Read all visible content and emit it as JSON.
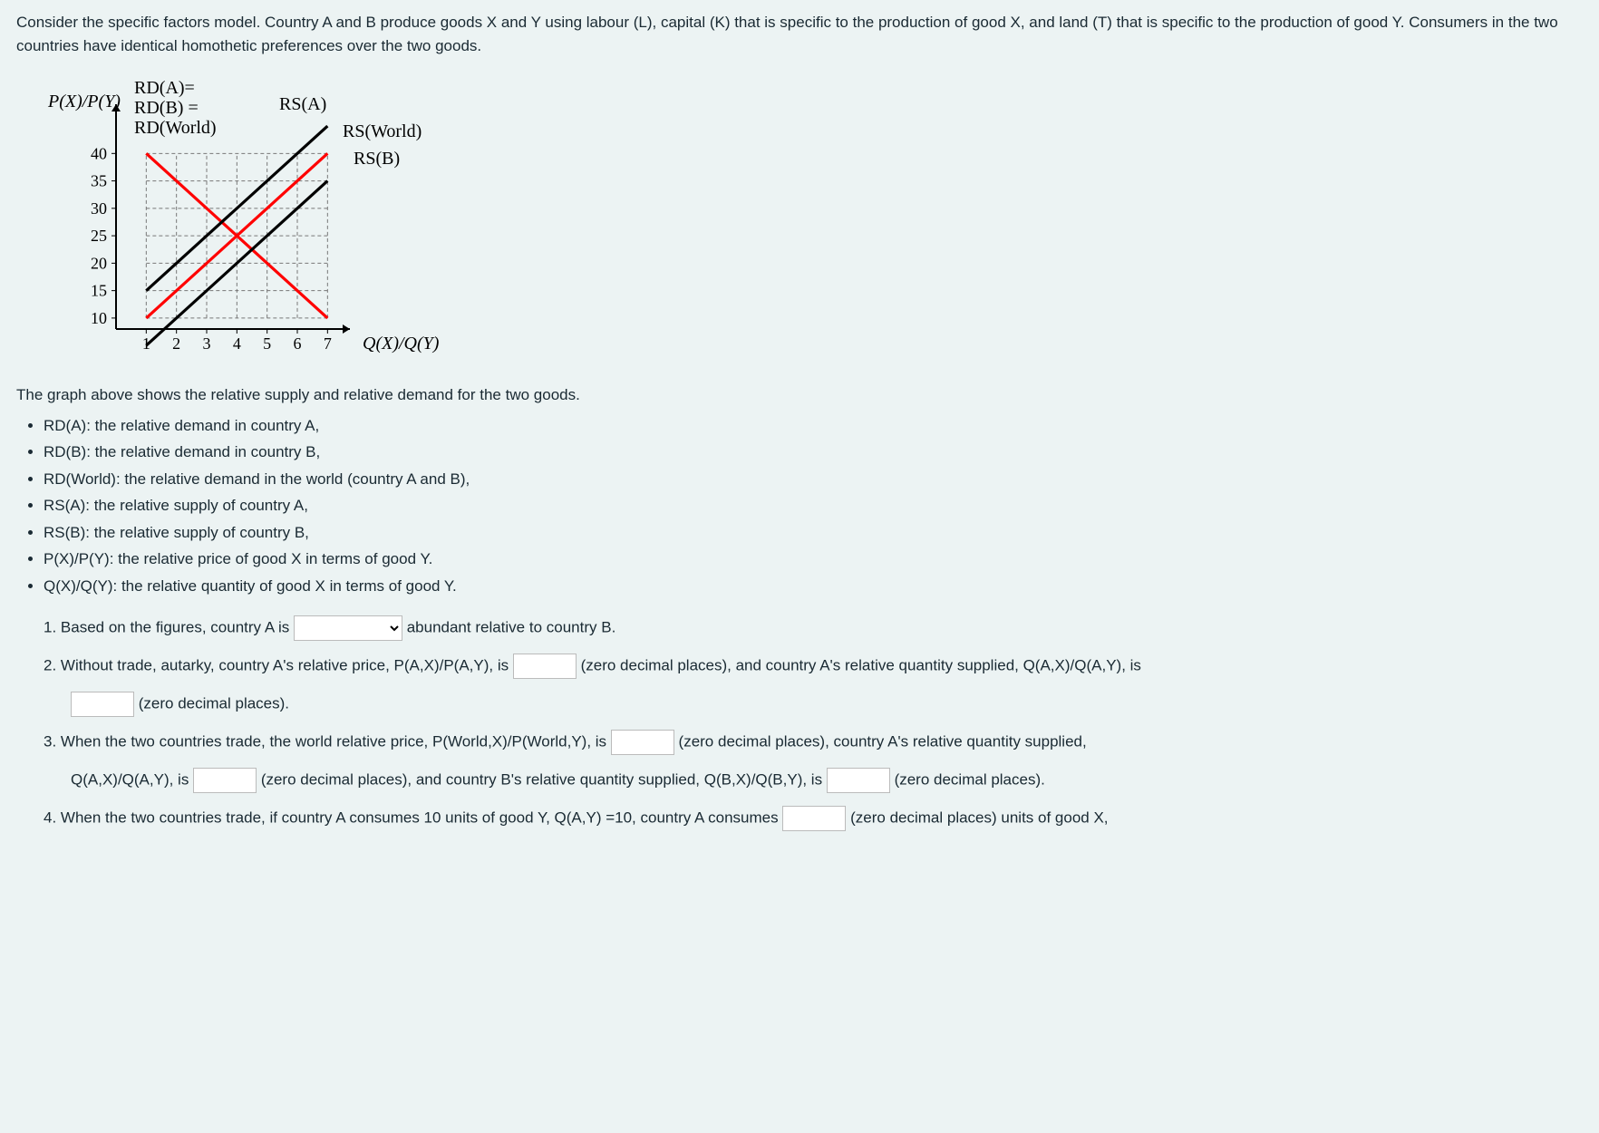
{
  "intro": "Consider the specific factors model. Country A and B produce goods X and Y using labour (L), capital (K) that is specific to the production of good X, and land (T) that is specific to the production of good Y. Consumers in the two countries have identical homothetic preferences over the two goods.",
  "chart_caption": "The graph above shows the relative supply and relative demand for the two goods.",
  "defs": [
    "RD(A): the relative demand in country A,",
    "RD(B): the relative demand in country B,",
    "RD(World): the relative demand in the world (country A and B),",
    "RS(A): the relative supply of country A,",
    "RS(B): the relative supply of country B,",
    "P(X)/P(Y): the relative price of good X in terms of good Y.",
    "Q(X)/Q(Y): the relative quantity of good X in terms of good Y."
  ],
  "q1": {
    "pre": "1. Based on the figures, country A is",
    "post": "abundant relative to country B."
  },
  "q2": {
    "pre": "2. Without trade, autarky, country A's relative price, P(A,X)/P(A,Y), is",
    "mid": "(zero decimal places), and country A's relative quantity supplied, Q(A,X)/Q(A,Y), is",
    "tail": "(zero decimal places)."
  },
  "q3": {
    "pre": "3. When the two countries trade, the world relative price, P(World,X)/P(World,Y), is",
    "mid1": "(zero decimal places), country A's relative quantity supplied,",
    "line2_pre": "Q(A,X)/Q(A,Y), is",
    "mid2": "(zero decimal places), and country B's relative quantity supplied, Q(B,X)/Q(B,Y), is",
    "tail": "(zero decimal places)."
  },
  "q4": {
    "pre": "4. When the two countries trade, if country A consumes 10 units of good Y, Q(A,Y) =10, country A consumes",
    "tail": "(zero decimal places) units of good X,"
  },
  "chart_data": {
    "type": "line",
    "xlabel": "Q(X)/Q(Y)",
    "ylabel": "P(X)/P(Y)",
    "x_ticks": [
      1,
      2,
      3,
      4,
      5,
      6,
      7
    ],
    "y_ticks": [
      10,
      15,
      20,
      25,
      30,
      35,
      40
    ],
    "xlim": [
      0,
      7.5
    ],
    "ylim": [
      8,
      46
    ],
    "series": [
      {
        "name": "RD(A) = RD(B) = RD(World)",
        "color": "#ff0000",
        "points": [
          [
            1,
            40
          ],
          [
            7,
            10
          ]
        ]
      },
      {
        "name": "RS(World)",
        "color": "#ff0000",
        "points": [
          [
            1,
            10
          ],
          [
            7,
            40
          ]
        ]
      },
      {
        "name": "RS(A)",
        "color": "#000000",
        "points": [
          [
            1,
            15
          ],
          [
            7,
            45
          ]
        ]
      },
      {
        "name": "RS(B)",
        "color": "#000000",
        "points": [
          [
            1,
            5
          ],
          [
            7,
            35
          ]
        ]
      }
    ],
    "gridlines_x": [
      1,
      2,
      3,
      4,
      5,
      6,
      7
    ],
    "gridlines_y": [
      10,
      15,
      20,
      25,
      30,
      35,
      40
    ],
    "legend_labels": {
      "rd": "RD(A)=\nRD(B) =\nRD(World)",
      "rsa": "RS(A)",
      "rsworld": "RS(World)",
      "rsb": "RS(B)"
    }
  }
}
